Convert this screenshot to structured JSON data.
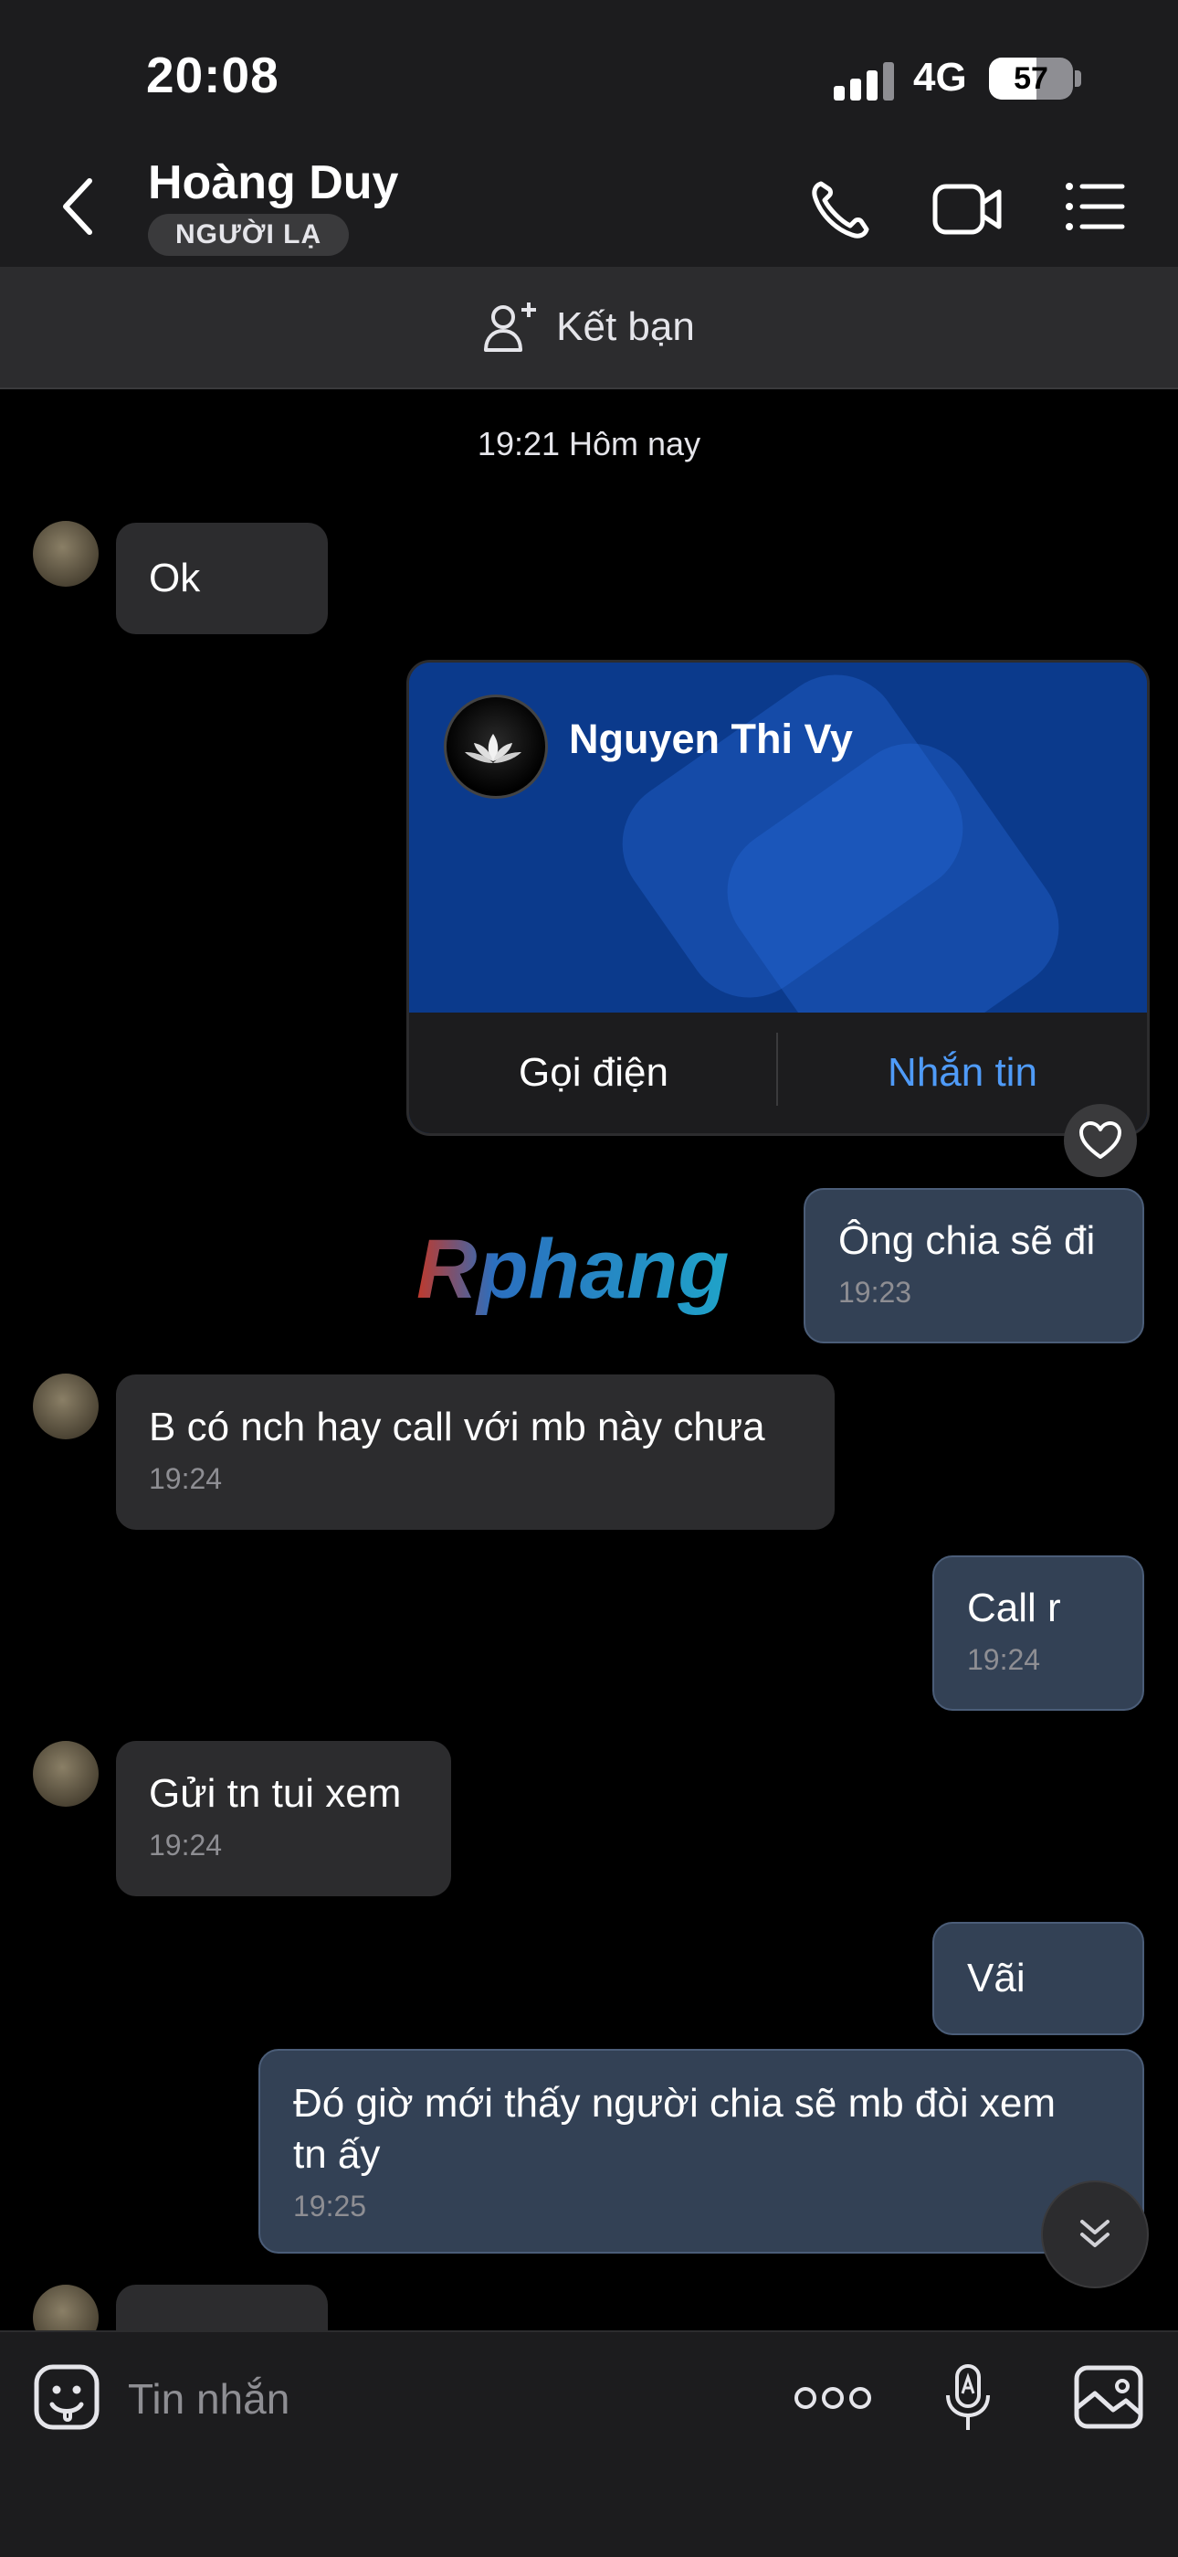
{
  "status_bar": {
    "time": "20:08",
    "network": "4G",
    "battery_level": "57",
    "battery_fraction": 0.57
  },
  "header": {
    "contact_name": "Hoàng Duy",
    "badge": "NGƯỜI LẠ",
    "icons": [
      "chevron-left-icon",
      "phone-icon",
      "video-camera-icon",
      "list-menu-icon"
    ]
  },
  "add_friend": {
    "label": "Kết bạn",
    "icon": "add-person-icon"
  },
  "date_separator": "19:21 Hôm nay",
  "messages": [
    {
      "direction": "in",
      "text": "Ok",
      "time": ""
    },
    {
      "direction": "out",
      "type": "contact_card",
      "card": {
        "name": "Nguyen Thi Vy",
        "call_label": "Gọi điện",
        "message_label": "Nhắn tin"
      }
    },
    {
      "direction": "out",
      "text": "Ông chia sẽ đi",
      "time": "19:23"
    },
    {
      "direction": "in",
      "text": "B có nch hay call với mb này chưa",
      "time": "19:24"
    },
    {
      "direction": "out",
      "text": "Call r",
      "time": "19:24"
    },
    {
      "direction": "in",
      "text": "Gửi tn tui xem",
      "time": "19:24"
    },
    {
      "direction": "out",
      "text": "Vãi",
      "time": ""
    },
    {
      "direction": "out",
      "text": "Đó giờ mới thấy người chia sẽ mb đòi xem tn ấy",
      "time": "19:25"
    },
    {
      "direction": "in",
      "text": ":)))",
      "time": ""
    }
  ],
  "watermark": "Rphang",
  "input": {
    "placeholder": "Tin nhắn"
  },
  "colors": {
    "outgoing_bubble": "#334155",
    "incoming_bubble": "#2c2c2e",
    "accent": "#4f9bf8",
    "card_background": "#0b3a8c"
  }
}
